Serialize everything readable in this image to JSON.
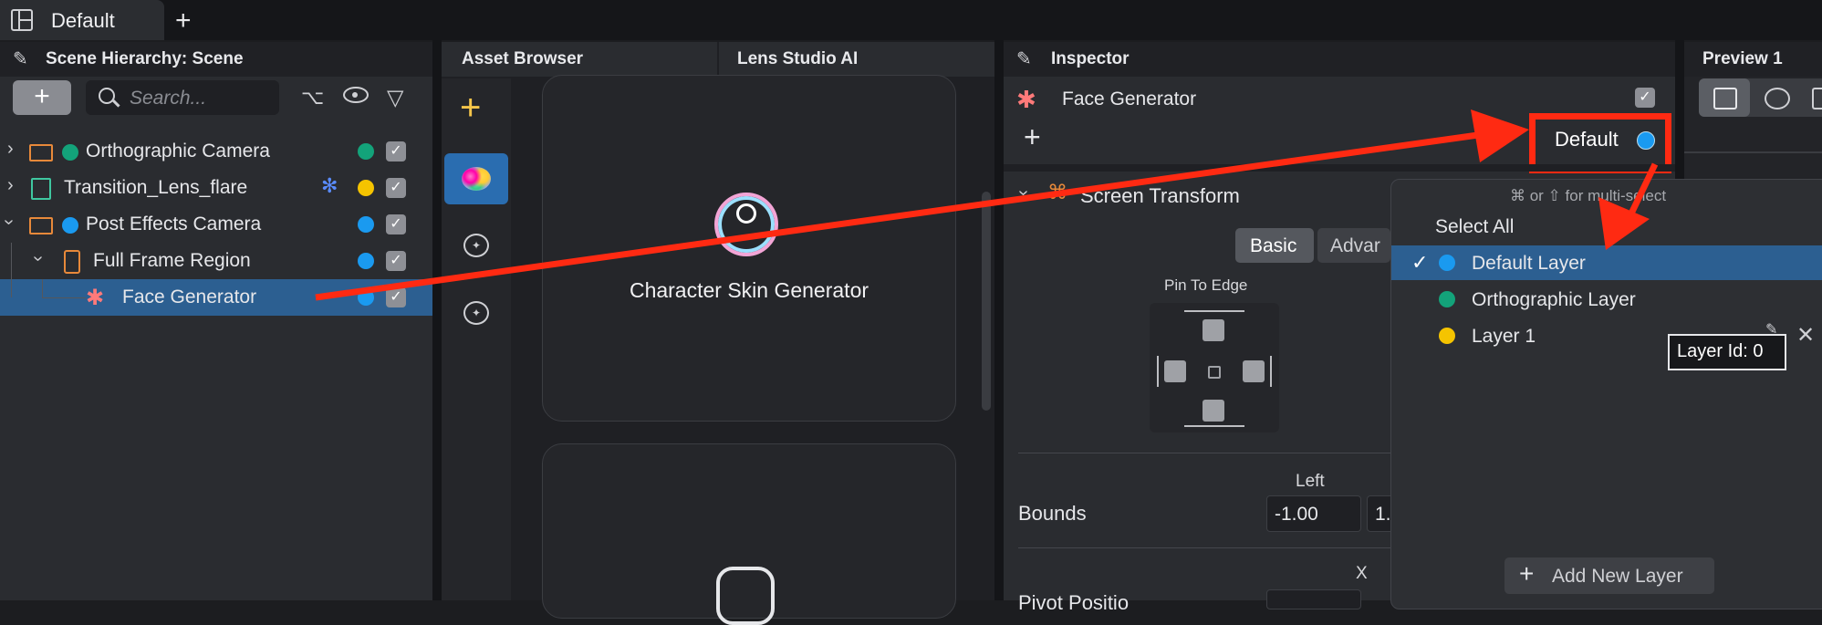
{
  "topbar": {
    "tab_label": "Default",
    "add_tab": "+"
  },
  "hierarchy": {
    "title": "Scene Hierarchy: Scene",
    "add_label": "+",
    "search_placeholder": "Search...",
    "items": [
      {
        "label": "Orthographic Camera",
        "dot_color": "#13a37a",
        "checked": true
      },
      {
        "label": "Transition_Lens_flare",
        "dot_color": "#f5c400",
        "checked": true
      },
      {
        "label": "Post Effects Camera",
        "dot_color": "#1a9af0",
        "checked": true
      },
      {
        "label": "Full Frame Region",
        "dot_color": "#1a9af0",
        "checked": true
      },
      {
        "label": "Face Generator",
        "dot_color": "#1a9af0",
        "checked": true
      }
    ]
  },
  "asset_browser": {
    "tab1": "Asset Browser",
    "tab2": "Lens Studio AI",
    "card1_label": "Character Skin Generator"
  },
  "inspector": {
    "title": "Inspector",
    "object_name": "Face Generator",
    "add_label": "+",
    "layer_button": "Default",
    "section_title": "Screen Transform",
    "basic_label": "Basic",
    "advanced_label": "Advar",
    "pin_to_edge": "Pin To Edge",
    "bounds_label": "Bounds",
    "left_label": "Left",
    "bounds_left_value": "-1.00",
    "bounds_right_value": "1.",
    "x_label": "X",
    "pivot_label": "Pivot Positio"
  },
  "preview": {
    "title": "Preview 1"
  },
  "layer_dropdown": {
    "hint": "⌘ or ⇧ for multi-select",
    "select_all": "Select All",
    "items": [
      {
        "label": "Default Layer",
        "color": "#1a9af0",
        "selected": true,
        "check": "✓"
      },
      {
        "label": "Orthographic Layer",
        "color": "#13a37a",
        "selected": false
      },
      {
        "label": "Layer 1",
        "color": "#f5c400",
        "selected": false
      }
    ],
    "tooltip": "Layer Id: 0",
    "add_new": "Add New Layer",
    "add_icon": "+"
  },
  "annotation": {
    "color": "#ff2a12"
  }
}
